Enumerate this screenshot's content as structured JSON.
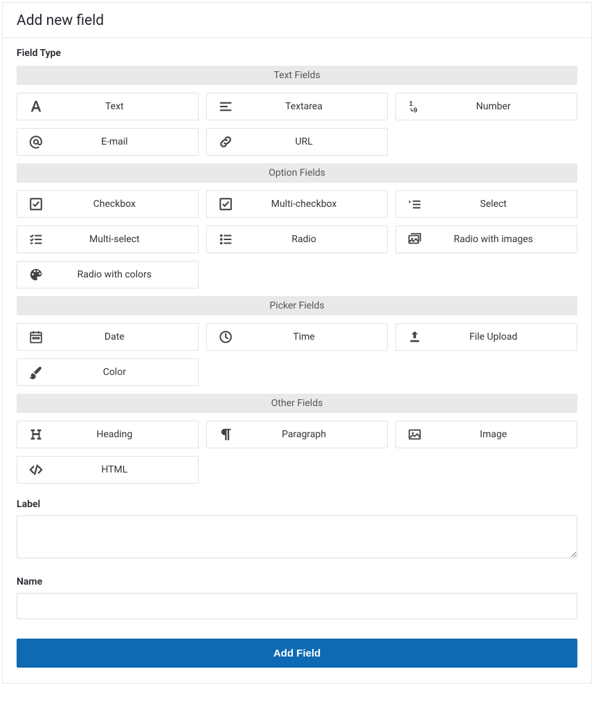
{
  "header": {
    "title": "Add new field"
  },
  "fieldTypeLabel": "Field Type",
  "groups": {
    "text": {
      "title": "Text Fields",
      "items": [
        "Text",
        "Textarea",
        "Number",
        "E-mail",
        "URL"
      ]
    },
    "option": {
      "title": "Option Fields",
      "items": [
        "Checkbox",
        "Multi-checkbox",
        "Select",
        "Multi-select",
        "Radio",
        "Radio with images",
        "Radio with colors"
      ]
    },
    "picker": {
      "title": "Picker Fields",
      "items": [
        "Date",
        "Time",
        "File Upload",
        "Color"
      ]
    },
    "other": {
      "title": "Other Fields",
      "items": [
        "Heading",
        "Paragraph",
        "Image",
        "HTML"
      ]
    }
  },
  "form": {
    "labelField": {
      "label": "Label",
      "value": ""
    },
    "nameField": {
      "label": "Name",
      "value": ""
    },
    "submit": "Add Field"
  }
}
